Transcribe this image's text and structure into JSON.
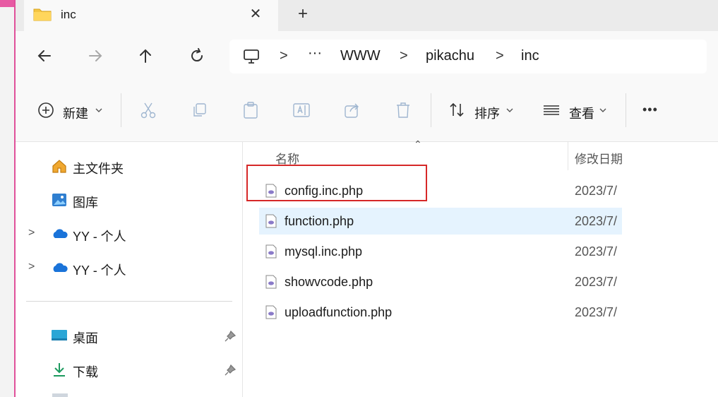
{
  "window": {
    "tab_title": "inc",
    "tab_close": "✕",
    "new_tab": "+"
  },
  "nav": {
    "back_icon": "arrow-left-icon",
    "forward_icon": "arrow-right-icon",
    "up_icon": "arrow-up-icon",
    "refresh_icon": "refresh-icon"
  },
  "breadcrumb": {
    "ellipsis": "···",
    "items": [
      "WWW",
      "pikachu",
      "inc"
    ],
    "separator": ">"
  },
  "commands": {
    "new_label": "新建",
    "sort_label": "排序",
    "view_label": "查看",
    "more": "•••"
  },
  "sidebar": {
    "items": [
      {
        "label": "主文件夹",
        "icon": "home-icon"
      },
      {
        "label": "图库",
        "icon": "gallery-icon"
      },
      {
        "label": "YY - 个人",
        "icon": "cloud-icon"
      },
      {
        "label": "YY - 个人",
        "icon": "cloud-icon"
      },
      {
        "label": "桌面",
        "icon": "desktop-icon"
      },
      {
        "label": "下载",
        "icon": "download-icon"
      }
    ],
    "chevron": ">"
  },
  "table": {
    "columns": [
      "名称",
      "修改日期"
    ],
    "rows": [
      {
        "name": "config.inc.php",
        "date": "2023/7/"
      },
      {
        "name": "function.php",
        "date": "2023/7/"
      },
      {
        "name": "mysql.inc.php",
        "date": "2023/7/"
      },
      {
        "name": "showvcode.php",
        "date": "2023/7/"
      },
      {
        "name": "uploadfunction.php",
        "date": "2023/7/"
      }
    ],
    "selected_index": 1
  },
  "colors": {
    "accent": "#0067c0",
    "selection": "#e5f3fe",
    "highlight_box": "#d62828",
    "folder": "#f4c542"
  }
}
